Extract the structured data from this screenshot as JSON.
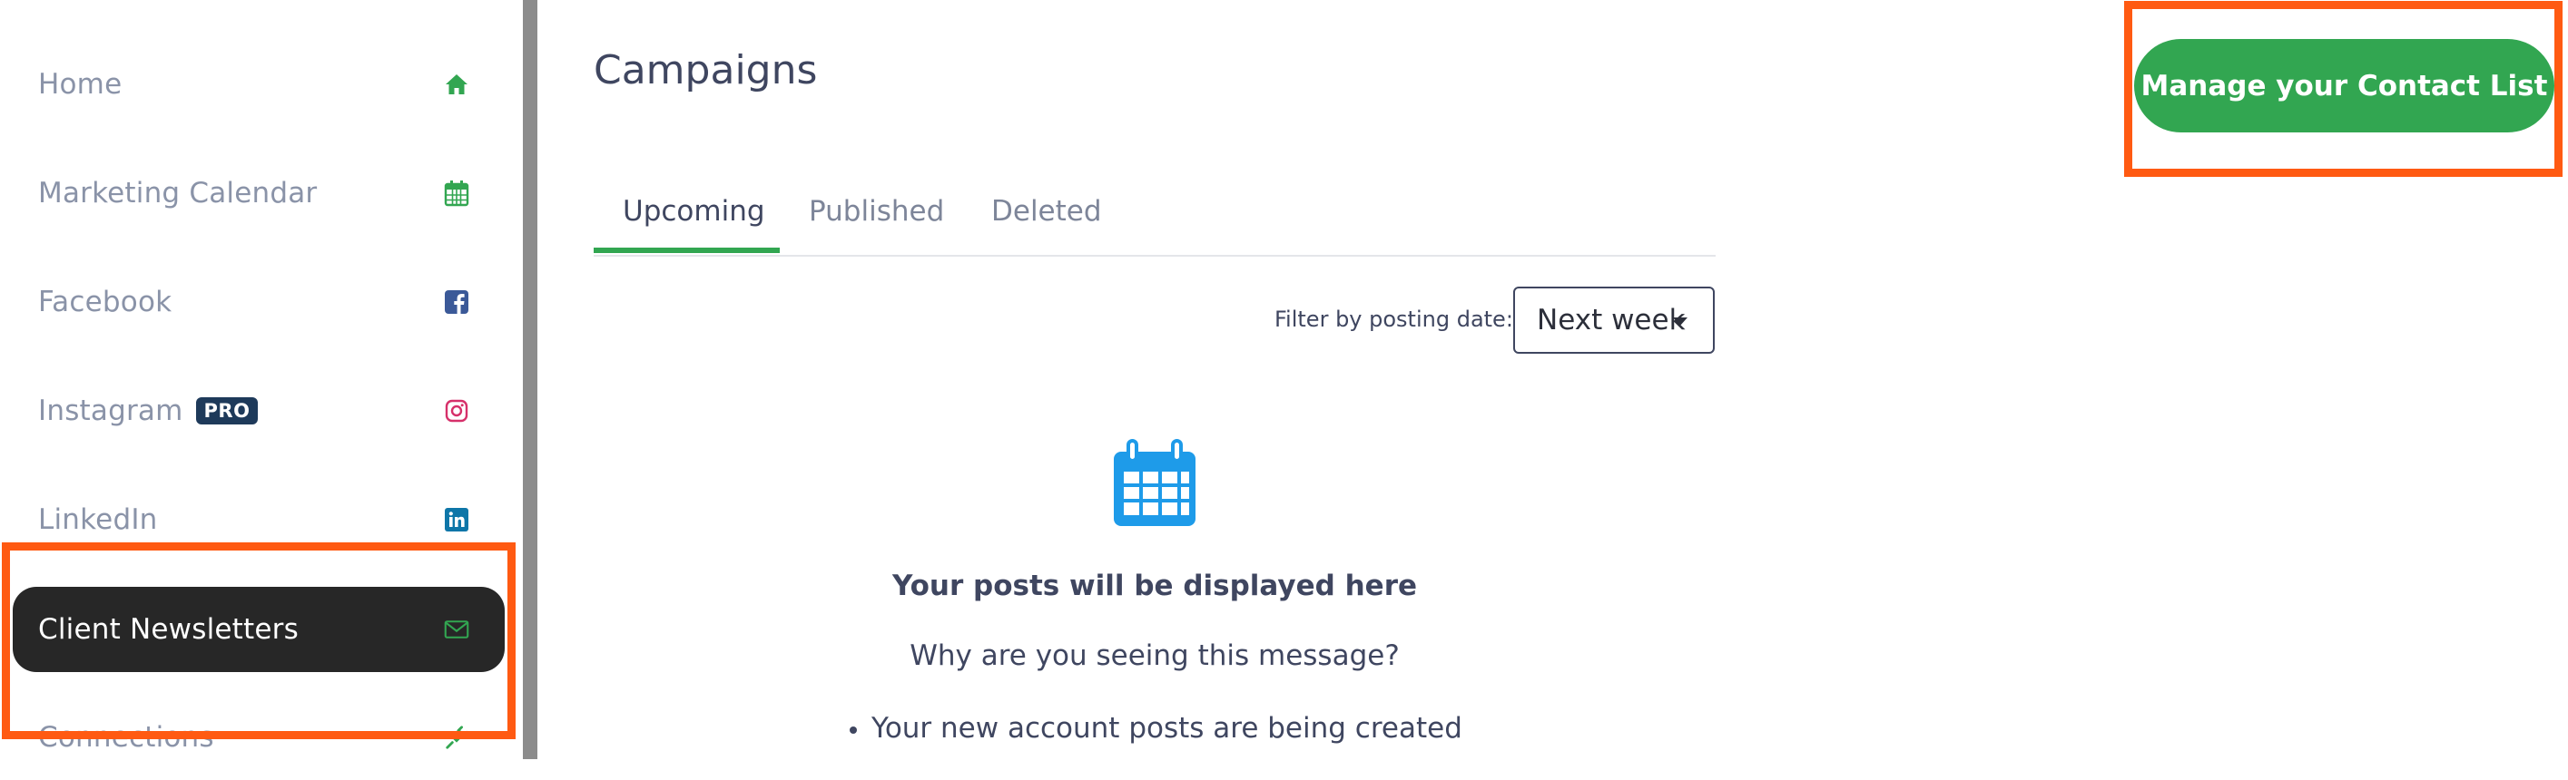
{
  "sidebar": {
    "items": [
      {
        "label": "Home",
        "icon": "home-icon"
      },
      {
        "label": "Marketing Calendar",
        "icon": "calendar-icon"
      },
      {
        "label": "Facebook",
        "icon": "facebook-icon"
      },
      {
        "label": "Instagram",
        "icon": "instagram-icon",
        "badge": "PRO"
      },
      {
        "label": "LinkedIn",
        "icon": "linkedin-icon"
      },
      {
        "label": "Client Newsletters",
        "icon": "envelope-icon",
        "active": true
      },
      {
        "label": "Connections",
        "icon": "plug-icon"
      }
    ]
  },
  "main": {
    "title": "Campaigns",
    "tabs": [
      {
        "label": "Upcoming",
        "active": true
      },
      {
        "label": "Published"
      },
      {
        "label": "Deleted"
      }
    ],
    "filter": {
      "label": "Filter by posting date:",
      "value": "Next week"
    },
    "empty_state": {
      "icon": "calendar-icon",
      "title": "Your posts will be displayed here",
      "question": "Why are you seeing this message?",
      "reasons": [
        "Your new account posts are being created"
      ]
    }
  },
  "header": {
    "cta_label": "Manage your Contact List"
  },
  "colors": {
    "accent_green": "#32a651",
    "highlight_orange": "#ff5a12",
    "sidebar_active": "#272727",
    "calendar_blue": "#1e9be9",
    "facebook_blue": "#3b5998",
    "linkedin_blue": "#0e76a8",
    "instagram_pink": "#d6306a",
    "pro_badge": "#1e3a5a"
  }
}
